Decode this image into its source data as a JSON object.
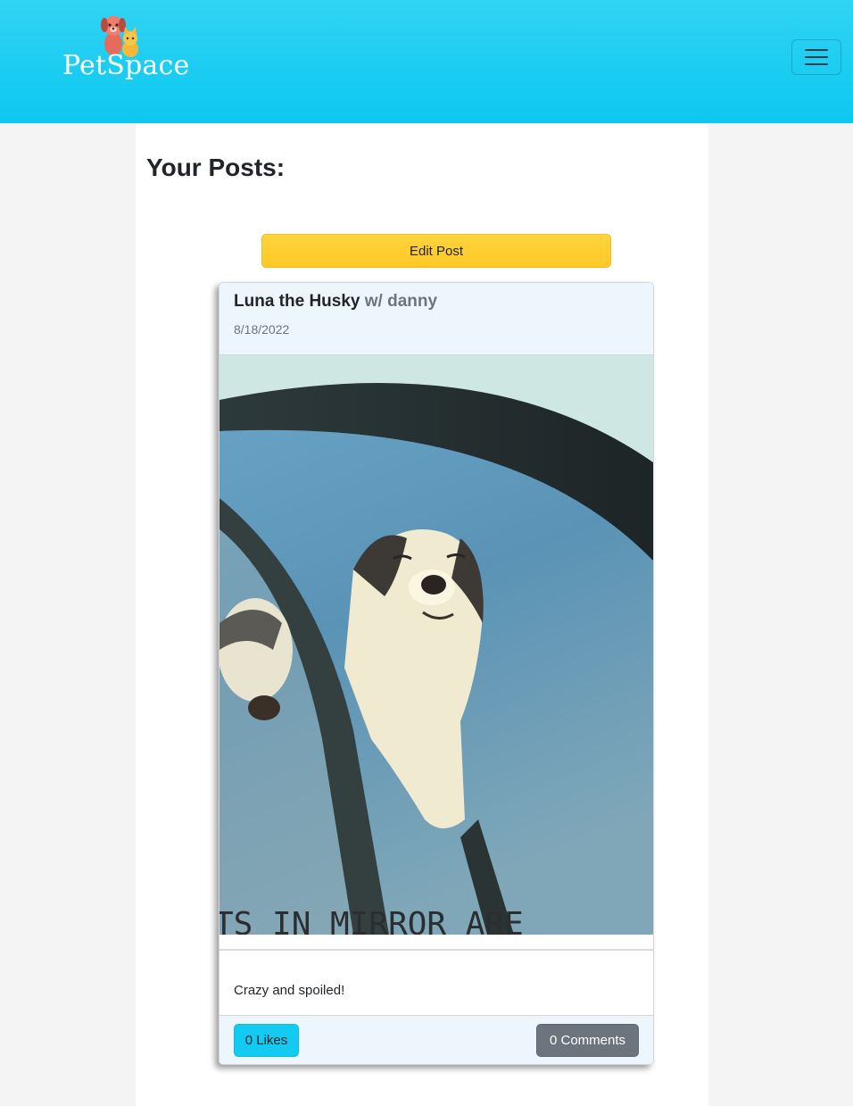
{
  "brand": {
    "name": "PetSpace",
    "logo_icon": "dog-and-cat-icon"
  },
  "header": {
    "menu_icon": "hamburger-menu-icon"
  },
  "page": {
    "title": "Your Posts:"
  },
  "actions": {
    "edit_label": "Edit Post"
  },
  "post": {
    "pet_name": "Luna the Husky",
    "owner": "w/ danny",
    "date": "8/18/2022",
    "image_icon": "husky-photo",
    "image_text": "TS IN MIRROR ARE",
    "caption": "Crazy and spoiled!",
    "likes_label": "0 Likes",
    "comments_label": "0 Comments"
  },
  "colors": {
    "header_bg": "#0cc8f0",
    "edit_button": "#ffc828",
    "likes_button": "#13cbf0",
    "comments_button": "#6c757d"
  }
}
